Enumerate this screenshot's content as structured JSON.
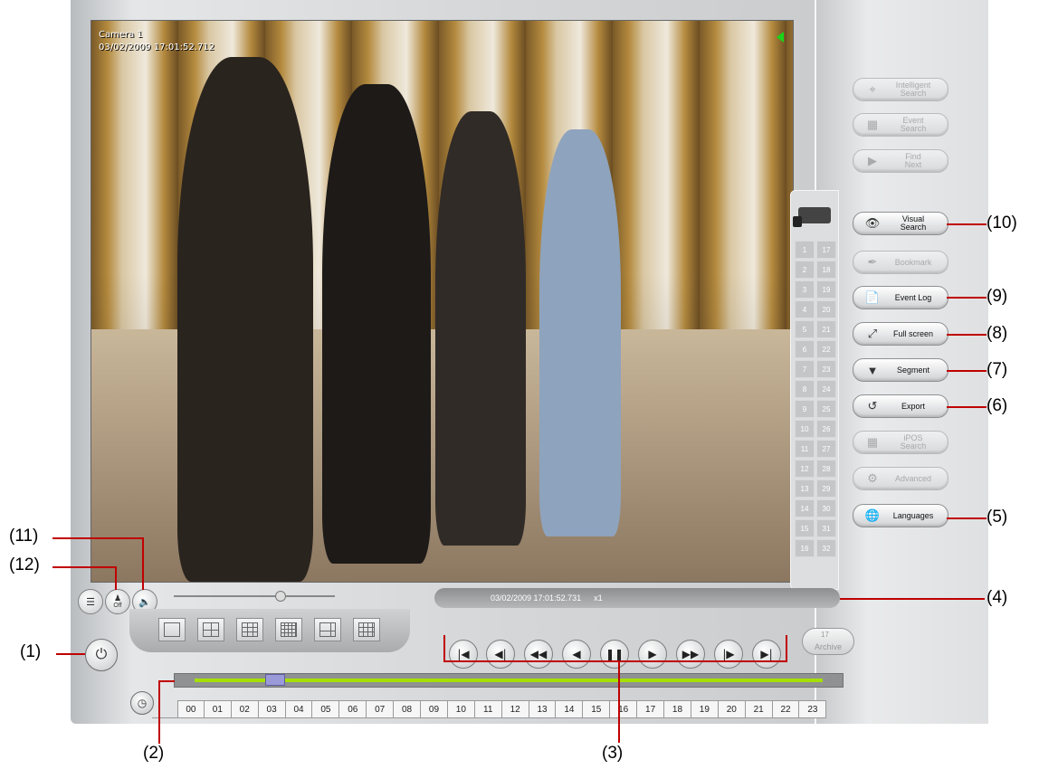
{
  "video": {
    "camera_label": "Camera 1",
    "timestamp": "03/02/2009 17:01:52.712"
  },
  "camera_channels": [
    "1",
    "17",
    "2",
    "18",
    "3",
    "19",
    "4",
    "20",
    "5",
    "21",
    "6",
    "22",
    "7",
    "23",
    "8",
    "24",
    "9",
    "25",
    "10",
    "26",
    "11",
    "27",
    "12",
    "28",
    "13",
    "29",
    "14",
    "30",
    "15",
    "31",
    "16",
    "32"
  ],
  "right_buttons": [
    {
      "label_line1": "Intelligent",
      "label_line2": "Search",
      "icon": "intelligent-search-icon",
      "enabled": false
    },
    {
      "label_line1": "Event",
      "label_line2": "Search",
      "icon": "event-search-icon",
      "enabled": false
    },
    {
      "label_line1": "Find",
      "label_line2": "Next",
      "icon": "find-next-icon",
      "enabled": false
    },
    {
      "label_line1": "Visual",
      "label_line2": "Search",
      "icon": "visual-search-icon",
      "enabled": true
    },
    {
      "label_line1": "Bookmark",
      "label_line2": "",
      "icon": "bookmark-icon",
      "enabled": false
    },
    {
      "label_line1": "Event Log",
      "label_line2": "",
      "icon": "event-log-icon",
      "enabled": true
    },
    {
      "label_line1": "Full screen",
      "label_line2": "",
      "icon": "full-screen-icon",
      "enabled": true
    },
    {
      "label_line1": "Segment",
      "label_line2": "",
      "icon": "segment-icon",
      "enabled": true
    },
    {
      "label_line1": "Export",
      "label_line2": "",
      "icon": "export-icon",
      "enabled": true
    },
    {
      "label_line1": "iPOS",
      "label_line2": "Search",
      "icon": "ipos-search-icon",
      "enabled": false
    },
    {
      "label_line1": "Advanced",
      "label_line2": "",
      "icon": "advanced-icon",
      "enabled": false
    },
    {
      "label_line1": "Languages",
      "label_line2": "",
      "icon": "languages-icon",
      "enabled": true
    }
  ],
  "status_bar": {
    "timestamp": "03/02/2009 17:01:52.731",
    "speed": "x1"
  },
  "small_buttons": {
    "snapshot_icon": "layers-icon",
    "off_label": "Off",
    "audio_icon": "speaker-icon"
  },
  "archive_label": "Archive",
  "archive_day": "17",
  "timeline_hours": [
    "00",
    "01",
    "02",
    "03",
    "04",
    "05",
    "06",
    "07",
    "08",
    "09",
    "10",
    "11",
    "12",
    "13",
    "14",
    "15",
    "16",
    "17",
    "18",
    "19",
    "20",
    "21",
    "22",
    "23"
  ],
  "callouts": {
    "c1": "(1)",
    "c2": "(2)",
    "c3": "(3)",
    "c4": "(4)",
    "c5": "(5)",
    "c6": "(6)",
    "c7": "(7)",
    "c8": "(8)",
    "c9": "(9)",
    "c10": "(10)",
    "c11": "(11)",
    "c12": "(12)"
  },
  "colors": {
    "callout_red": "#c00000",
    "timeline_green": "#a6e000"
  }
}
